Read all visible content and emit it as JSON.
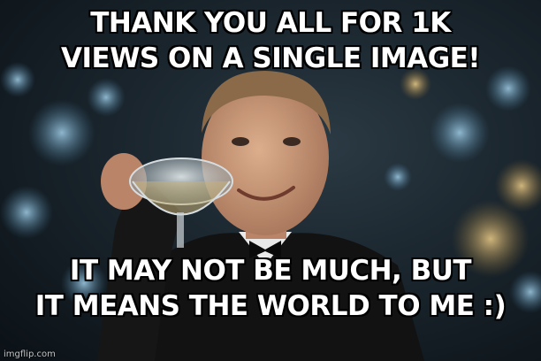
{
  "meme": {
    "top_text": [
      "THANK YOU ALL FOR 1K",
      "VIEWS ON A SINGLE IMAGE!"
    ],
    "bottom_text": [
      "IT MAY NOT BE MUCH, BUT",
      "IT MEANS THE WORLD TO ME :)"
    ],
    "watermark": "imgflip.com"
  },
  "colors": {
    "caption_text": "#ffffff",
    "caption_outline": "#000000",
    "background": "#1a252d",
    "suit": "#121212",
    "skin": "#c99878",
    "hair": "#8a6a48",
    "bokeh_blue": "#6fa3c4",
    "bokeh_gold": "#d9b36a"
  }
}
